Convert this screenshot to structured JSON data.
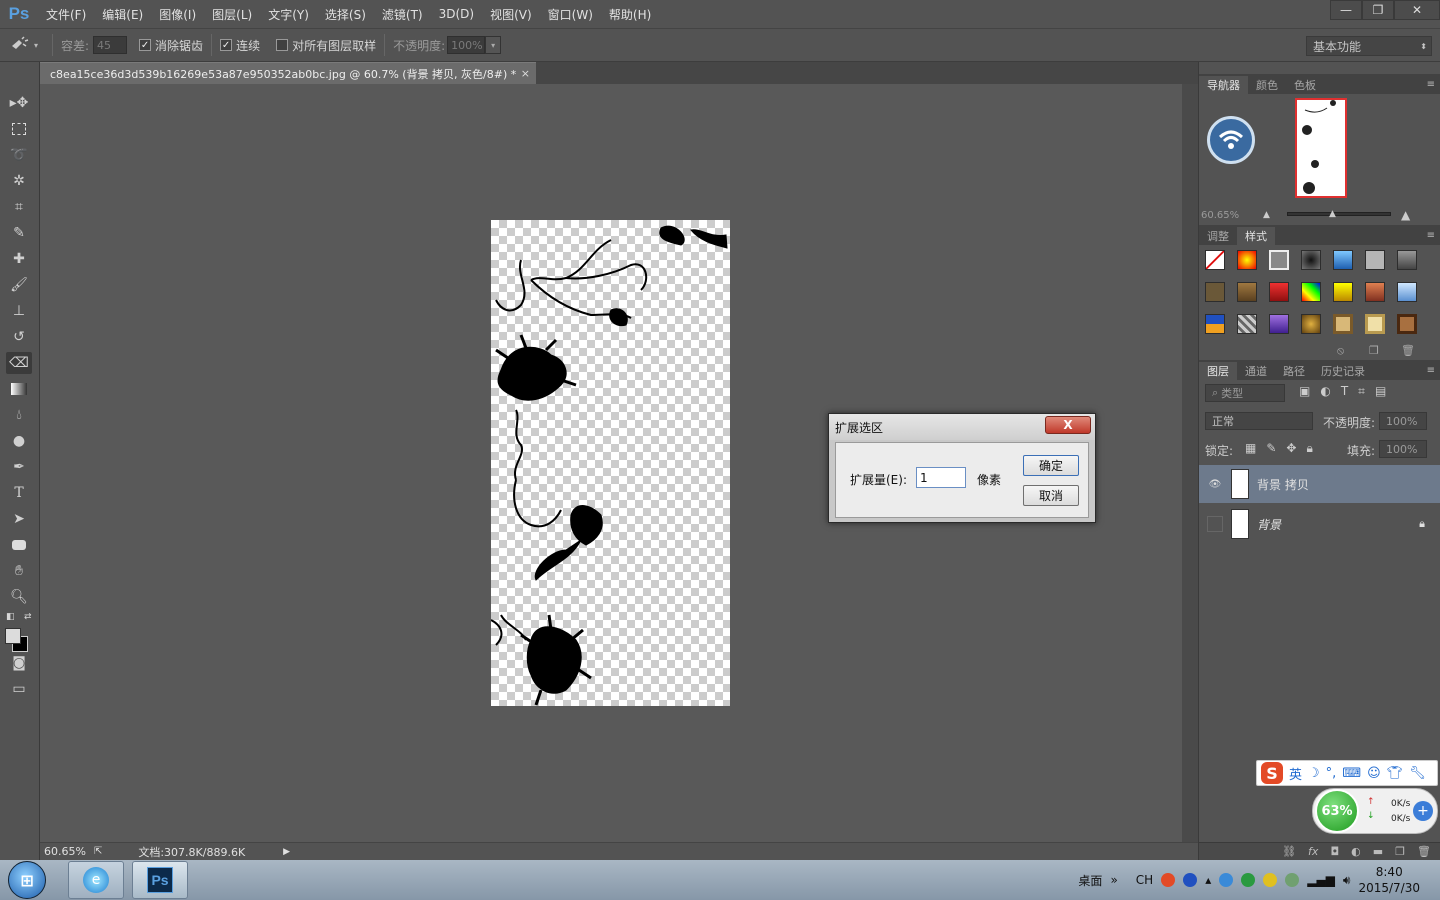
{
  "app": {
    "logo": "Ps"
  },
  "menu": [
    {
      "label": "文件(F)"
    },
    {
      "label": "编辑(E)"
    },
    {
      "label": "图像(I)"
    },
    {
      "label": "图层(L)"
    },
    {
      "label": "文字(Y)"
    },
    {
      "label": "选择(S)"
    },
    {
      "label": "滤镜(T)"
    },
    {
      "label": "3D(D)"
    },
    {
      "label": "视图(V)"
    },
    {
      "label": "窗口(W)"
    },
    {
      "label": "帮助(H)"
    }
  ],
  "window_buttons": {
    "minimize": "—",
    "restore": "❐",
    "close": "✕"
  },
  "options": {
    "tolerance_label": "容差:",
    "tolerance_value": "45",
    "antialias_label": "消除锯齿",
    "contiguous_label": "连续",
    "sample_all_label": "对所有图层取样",
    "opacity_label": "不透明度:",
    "opacity_value": "100%",
    "workspace": "基本功能"
  },
  "document": {
    "tab_title": "c8ea15ce36d3d539b16269e53a87e950352ab0bc.jpg @ 60.7% (背景 拷贝, 灰色/8#) *",
    "tab_close": "×"
  },
  "status": {
    "zoom": "60.65%",
    "doc_size": "文档:307.8K/889.6K"
  },
  "dialog": {
    "title": "扩展选区",
    "close": "X",
    "expand_label": "扩展量(E):",
    "expand_value": "1",
    "unit": "像素",
    "ok": "确定",
    "cancel": "取消"
  },
  "navigator": {
    "tabs": [
      "导航器",
      "颜色",
      "色板"
    ],
    "zoom": "60.65%"
  },
  "styles_panel": {
    "tabs": [
      "调整",
      "样式"
    ]
  },
  "layers_panel": {
    "tabs": [
      "图层",
      "通道",
      "路径",
      "历史记录"
    ],
    "filter_kind": "类型",
    "blend_mode": "正常",
    "opacity_label": "不透明度:",
    "opacity_value": "100%",
    "lock_label": "锁定:",
    "fill_label": "填充:",
    "fill_value": "100%",
    "layers": [
      {
        "name": "背景 拷贝",
        "visible": true,
        "selected": true
      },
      {
        "name": "背景",
        "visible": false,
        "locked": true
      }
    ]
  },
  "ime": {
    "logo": "S",
    "mode": "英"
  },
  "netmon": {
    "percent": "63%",
    "up": "0K/s",
    "down": "0K/s"
  },
  "taskbar": {
    "desktop_label": "桌面",
    "lang": "CH",
    "time": "8:40",
    "date": "2015/7/30"
  }
}
